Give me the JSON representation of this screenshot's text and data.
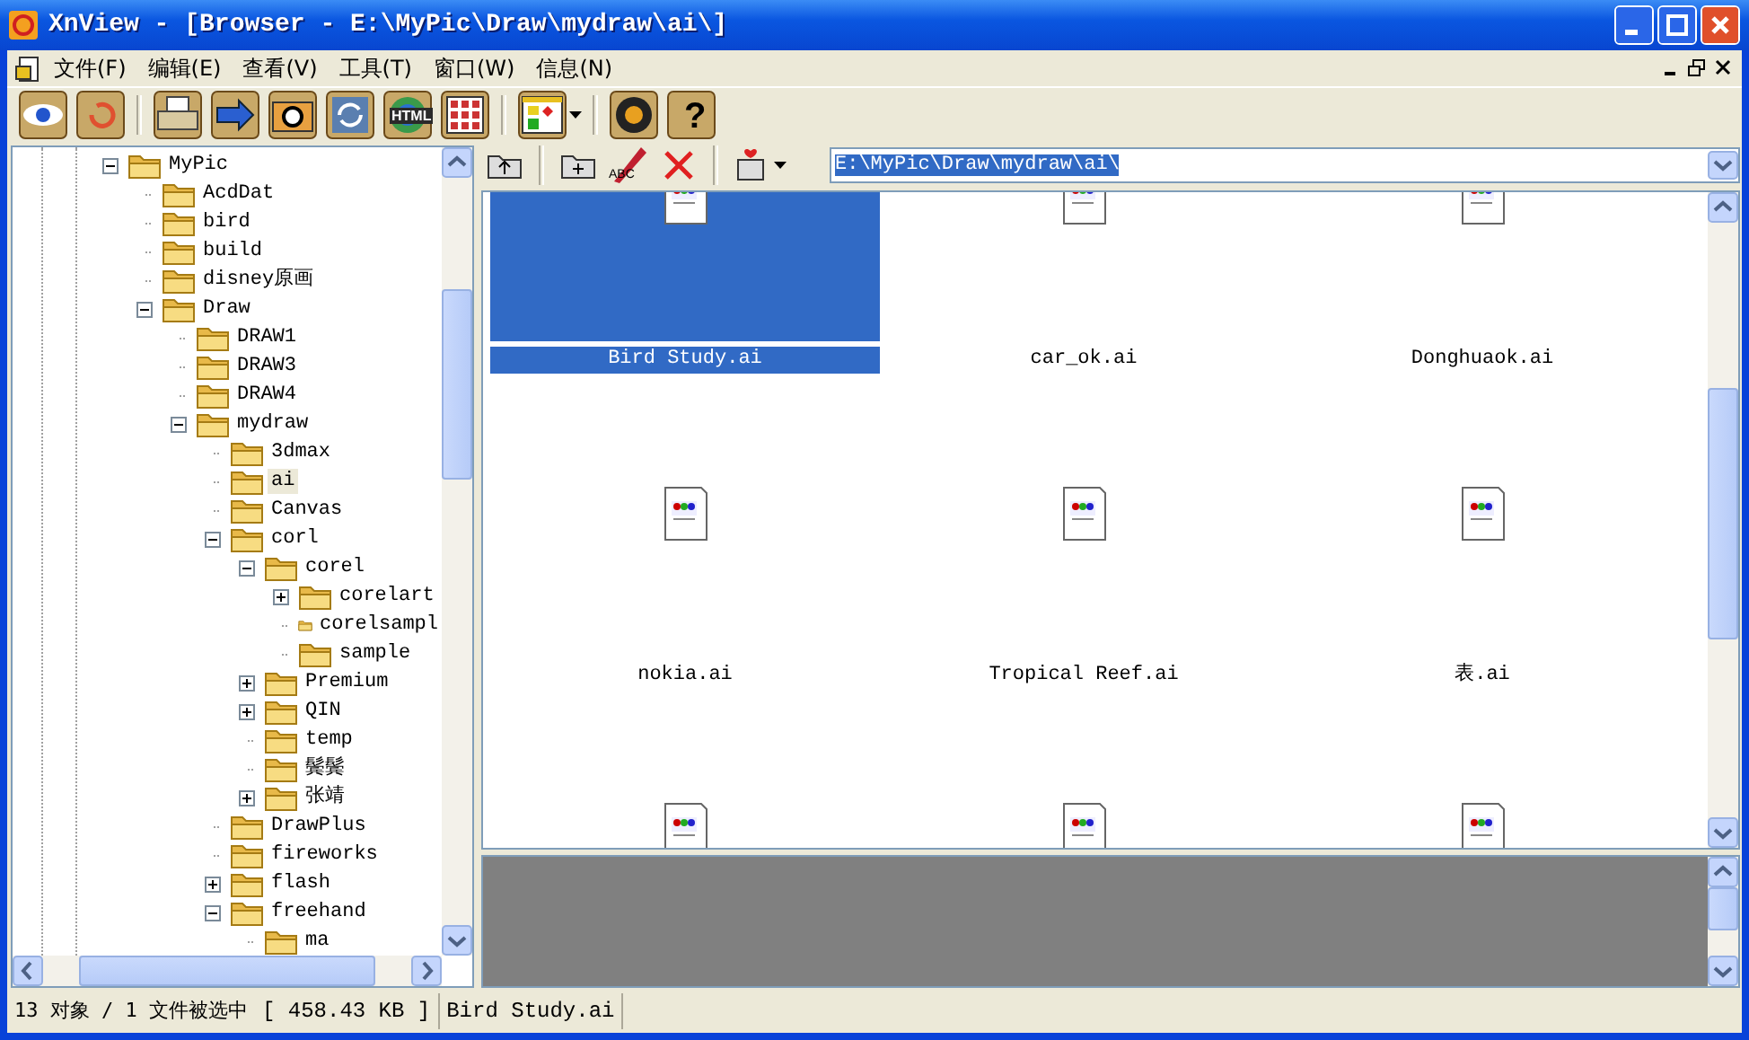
{
  "window": {
    "title": "XnView - [Browser - E:\\MyPic\\Draw\\mydraw\\ai\\]"
  },
  "menu": [
    "文件(F)",
    "编辑(E)",
    "查看(V)",
    "工具(T)",
    "窗口(W)",
    "信息(N)"
  ],
  "toolbar": [
    {
      "kind": "eye"
    },
    {
      "kind": "refresh"
    },
    {
      "kind": "sep"
    },
    {
      "kind": "print"
    },
    {
      "kind": "convert"
    },
    {
      "kind": "camera"
    },
    {
      "kind": "sync"
    },
    {
      "kind": "html",
      "label": "HTML"
    },
    {
      "kind": "grid"
    },
    {
      "kind": "sep"
    },
    {
      "kind": "palette"
    },
    {
      "kind": "sep"
    },
    {
      "kind": "gear"
    },
    {
      "kind": "help",
      "label": "?"
    }
  ],
  "tree": [
    {
      "label": "MyPic",
      "expanded": true,
      "children": [
        {
          "label": "AcdDat"
        },
        {
          "label": "bird"
        },
        {
          "label": "build"
        },
        {
          "label": "disney原画"
        },
        {
          "label": "Draw",
          "expanded": true,
          "children": [
            {
              "label": "DRAW1"
            },
            {
              "label": "DRAW3"
            },
            {
              "label": "DRAW4"
            },
            {
              "label": "mydraw",
              "expanded": true,
              "children": [
                {
                  "label": "3dmax"
                },
                {
                  "label": "ai",
                  "selected": true
                },
                {
                  "label": "Canvas"
                },
                {
                  "label": "corl",
                  "expanded": true,
                  "children": [
                    {
                      "label": "corel",
                      "expanded": true,
                      "children": [
                        {
                          "label": "corelart",
                          "expanded": false
                        },
                        {
                          "label": "corelsampl"
                        },
                        {
                          "label": "sample"
                        }
                      ]
                    },
                    {
                      "label": "Premium",
                      "expanded": false
                    },
                    {
                      "label": "QIN",
                      "expanded": false
                    },
                    {
                      "label": "temp"
                    },
                    {
                      "label": "鬓鬓"
                    },
                    {
                      "label": "张靖",
                      "expanded": false
                    }
                  ]
                },
                {
                  "label": "DrawPlus"
                },
                {
                  "label": "fireworks"
                },
                {
                  "label": "flash",
                  "expanded": false
                },
                {
                  "label": "freehand",
                  "expanded": true,
                  "children": [
                    {
                      "label": "ma"
                    }
                  ]
                }
              ]
            }
          ]
        }
      ]
    }
  ],
  "browser_toolbar": [
    {
      "kind": "up"
    },
    {
      "kind": "sep"
    },
    {
      "kind": "newfolder"
    },
    {
      "kind": "rename",
      "label": "ABC"
    },
    {
      "kind": "delete"
    },
    {
      "kind": "sep"
    },
    {
      "kind": "action"
    }
  ],
  "address": "E:\\MyPic\\Draw\\mydraw\\ai\\",
  "files": [
    {
      "name": "Bird Study.ai",
      "selected": true
    },
    {
      "name": "car_ok.ai",
      "selected": false
    },
    {
      "name": "Donghuaok.ai",
      "selected": false
    },
    {
      "name": "nokia.ai",
      "selected": false
    },
    {
      "name": "Tropical Reef.ai",
      "selected": false
    },
    {
      "name": "表.ai",
      "selected": false
    },
    {
      "selected": false
    },
    {
      "selected": false
    },
    {
      "selected": false
    }
  ],
  "status_bar": [
    "13 对象 / 1 文件被选中",
    "[ 458.43 KB ]",
    "Bird Study.ai"
  ]
}
